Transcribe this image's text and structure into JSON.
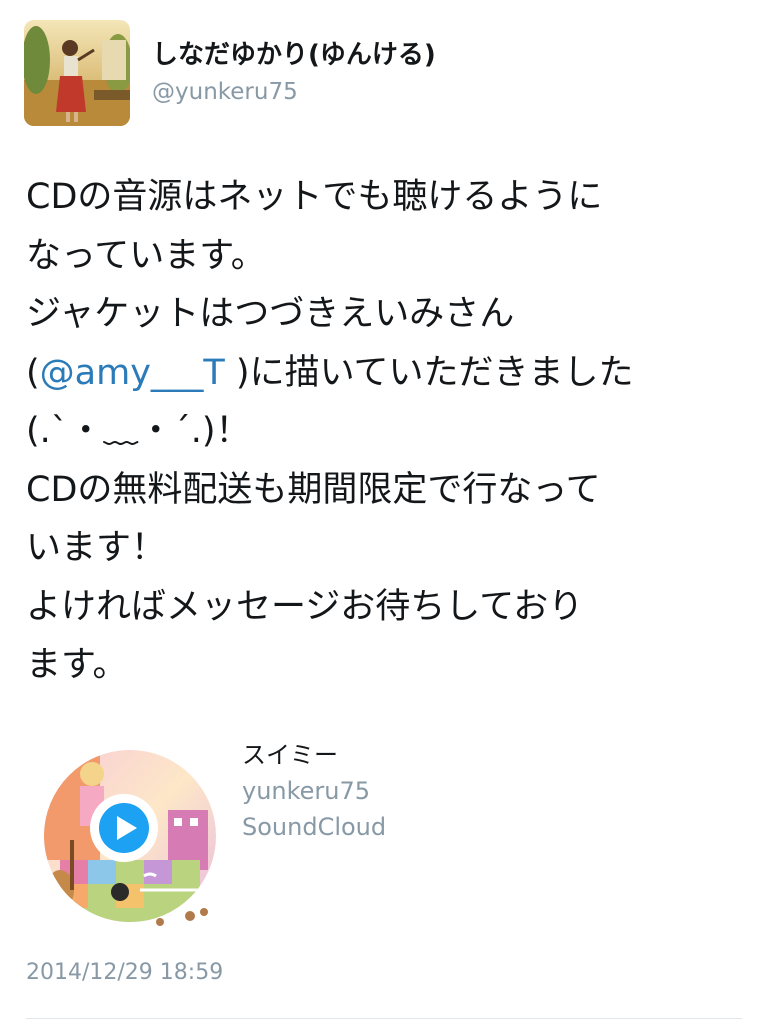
{
  "user": {
    "display_name": "しなだゆかり(ゆんける)",
    "handle": "@yunkeru75"
  },
  "tweet": {
    "lines": [
      {
        "text": "CDの音源はネットでも聴けるように"
      },
      {
        "text": "なっています。"
      },
      {
        "text": "ジャケットはつづきえいみさん"
      },
      {
        "before": "(",
        "mention": "@amy___T",
        "after": " )に描いていただきました"
      },
      {
        "text": "(.`・﹏・´.)！"
      },
      {
        "text": "CDの無料配送も期間限定で行なって"
      },
      {
        "text": "います！"
      },
      {
        "text": "よければメッセージお待ちしており"
      },
      {
        "text": "ます。"
      }
    ],
    "timestamp": "2014/12/29 18:59"
  },
  "card": {
    "title": "スイミー",
    "author": "yunkeru75",
    "site": "SoundCloud"
  },
  "colors": {
    "text": "#14171a",
    "secondary": "#8899a6",
    "link": "#2b7bb9",
    "play_blue": "#1da1f2"
  }
}
